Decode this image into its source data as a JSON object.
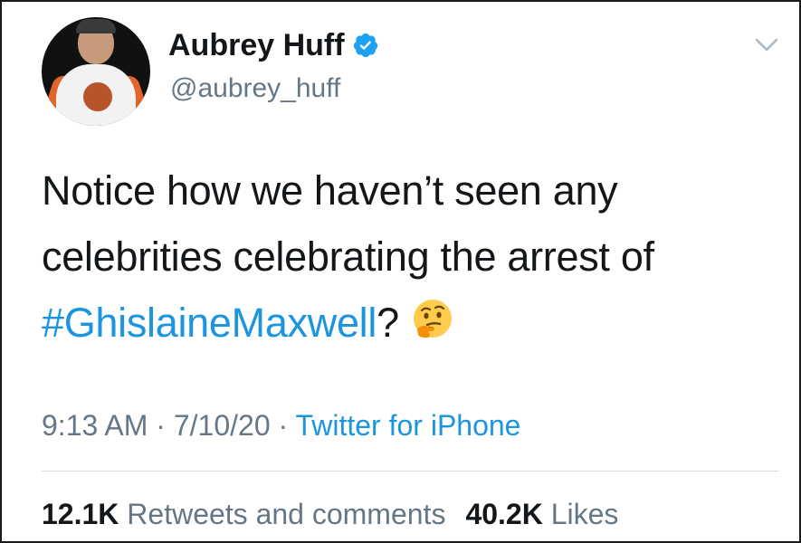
{
  "author": {
    "display_name": "Aubrey Huff",
    "handle": "@aubrey_huff",
    "verified": true
  },
  "tweet": {
    "text_line1": "Notice how we haven’t seen any",
    "text_line2": "celebrities celebrating the arrest of",
    "hashtag": "#GhislaineMaxwell",
    "trailing": "?",
    "emoji": "thinking-face-icon"
  },
  "meta": {
    "time": "9:13 AM",
    "separator": " · ",
    "date": "7/10/20",
    "source": "Twitter for iPhone"
  },
  "stats": {
    "retweets_count": "12.1K",
    "retweets_label": "Retweets and comments",
    "likes_count": "40.2K",
    "likes_label": "Likes"
  },
  "colors": {
    "link": "#1b95e0",
    "muted": "#657786",
    "text": "#14171a",
    "verified": "#1da1f2"
  }
}
